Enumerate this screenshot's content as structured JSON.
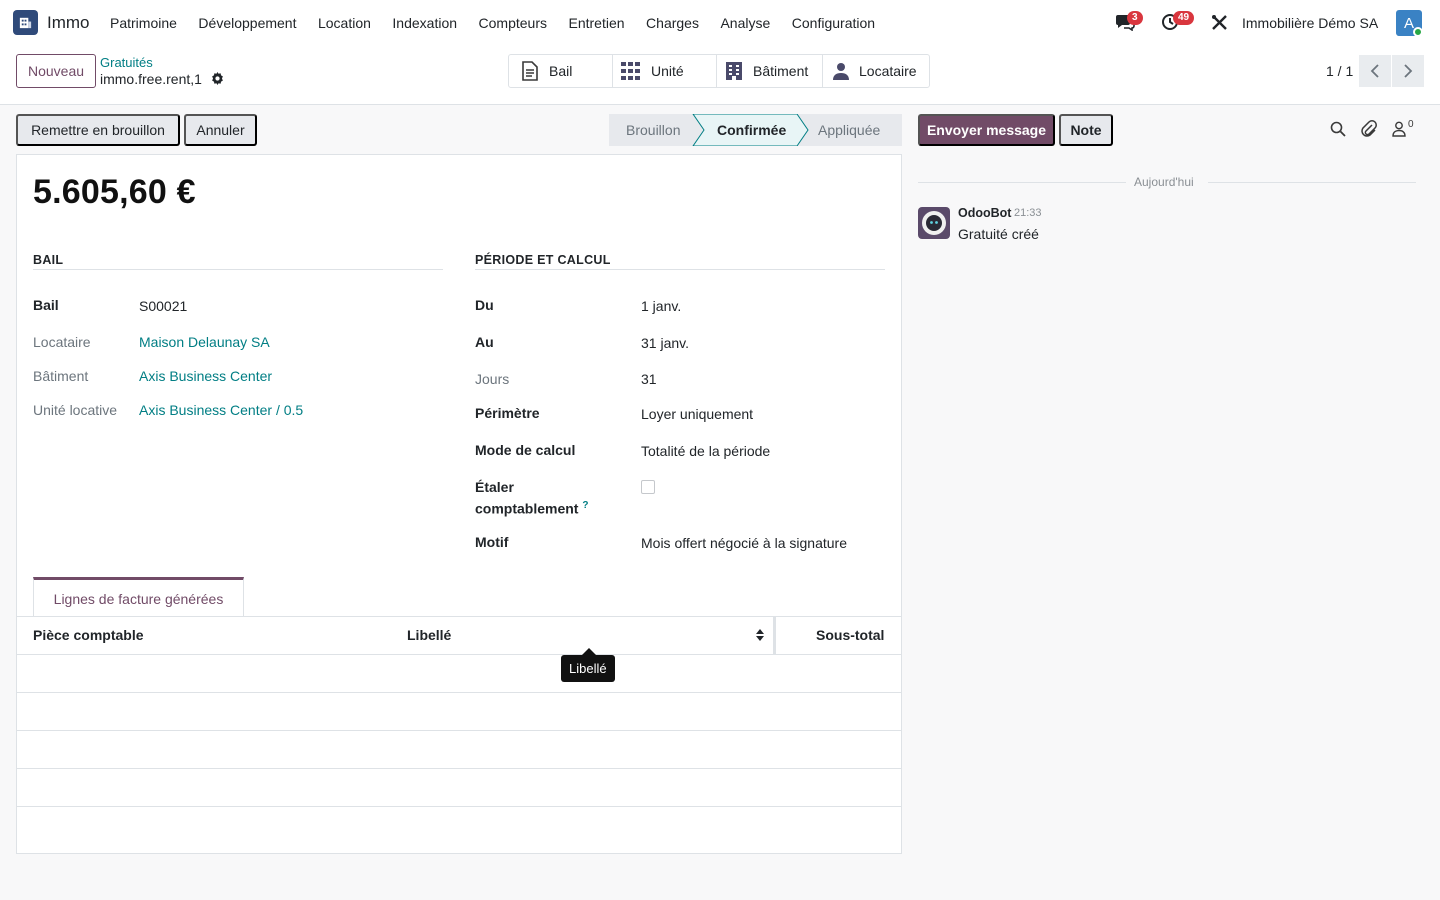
{
  "navbar": {
    "app_name": "Immo",
    "menu": [
      "Patrimoine",
      "Développement",
      "Location",
      "Indexation",
      "Compteurs",
      "Entretien",
      "Charges",
      "Analyse",
      "Configuration"
    ],
    "messages_count": "3",
    "activities_count": "49",
    "company": "Immobilière Démo SA",
    "avatar_letter": "A"
  },
  "control": {
    "new_label": "Nouveau",
    "breadcrumb_parent": "Gratuités",
    "breadcrumb_current": "immo.free.rent,1",
    "smart_buttons": [
      "Bail",
      "Unité",
      "Bâtiment",
      "Locataire"
    ],
    "pager": "1 / 1"
  },
  "statusbar": {
    "draft_button": "Remettre en brouillon",
    "cancel_button": "Annuler",
    "stages": [
      "Brouillon",
      "Confirmée",
      "Appliquée"
    ],
    "active_stage": "Confirmée"
  },
  "form": {
    "amount": "5.605,60 €",
    "lease_section": {
      "title": "BAIL",
      "fields": [
        {
          "label": "Bail",
          "value": "S00021"
        },
        {
          "label": "Locataire",
          "value": "Maison Delaunay SA"
        },
        {
          "label": "Bâtiment",
          "value": "Axis Business Center"
        },
        {
          "label": "Unité locative",
          "value": "Axis Business Center / 0.5"
        }
      ]
    },
    "period_section": {
      "title": "PÉRIODE ET CALCUL",
      "fields": [
        {
          "label": "Du",
          "value": "1 janv."
        },
        {
          "label": "Au",
          "value": "31 janv."
        },
        {
          "label": "Jours",
          "value": "31"
        },
        {
          "label": "Périmètre",
          "value": "Loyer uniquement"
        },
        {
          "label": "Mode de calcul",
          "value": "Totalité de la période"
        },
        {
          "label": "Étaler comptablement",
          "value": ""
        },
        {
          "label": "Motif",
          "value": "Mois offert négocié à la signature"
        }
      ],
      "label_etaler_line1": "Étaler",
      "label_etaler_line2": "comptablement",
      "help_mark": "?"
    },
    "tab_label": "Lignes de facture générées",
    "table_headers": [
      "Pièce comptable",
      "Libellé",
      "Sous-total"
    ],
    "tooltip": "Libellé"
  },
  "chatter": {
    "send_message": "Envoyer message",
    "note": "Note",
    "followers_count": "0",
    "date_separator": "Aujourd'hui",
    "author": "OdooBot",
    "time": "21:33",
    "message": "Gratuité créé"
  },
  "colors": {
    "brand": "#714b67",
    "link": "#017e84",
    "badge": "#d9363e"
  }
}
